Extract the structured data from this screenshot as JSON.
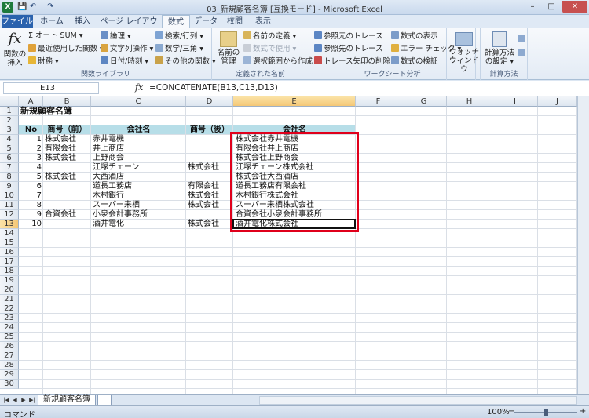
{
  "window": {
    "title": "03_新規顧客名簿  [互換モード] - Microsoft Excel",
    "app_icon": "X",
    "minimize": "–",
    "maximize": "□",
    "close": "✕"
  },
  "quick_access": [
    "💾",
    "↶",
    "↷"
  ],
  "ribbon_tabs": {
    "file": "ファイル",
    "home": "ホーム",
    "insert": "挿入",
    "page_layout": "ページ レイアウト",
    "formulas": "数式",
    "data": "データ",
    "review": "校閲",
    "view": "表示"
  },
  "ribbon": {
    "function_library": {
      "label": "関数ライブラリ",
      "insert_function": "関数の\n挿入",
      "autosum": "Σ オート SUM ▾",
      "recent": "最近使用した関数 ▾",
      "financial": "財務 ▾",
      "logical": "論理 ▾",
      "text": "文字列操作 ▾",
      "datetime": "日付/時刻 ▾",
      "lookup": "検索/行列 ▾",
      "math": "数学/三角 ▾",
      "more": "その他の関数 ▾"
    },
    "defined_names": {
      "label": "定義された名前",
      "name_manager": "名前の\n管理",
      "define_name": "名前の定義 ▾",
      "use_in_formula": "数式で使用 ▾",
      "create_from_selection": "選択範囲から作成"
    },
    "formula_auditing": {
      "label": "ワークシート分析",
      "trace_precedents": "参照元のトレース",
      "trace_dependents": "参照先のトレース",
      "remove_arrows": "トレース矢印の削除 ▾",
      "show_formulas": "数式の表示",
      "error_check": "エラー チェック ▾",
      "evaluate": "数式の検証",
      "watch": "ウォッチ\nウィンドウ"
    },
    "calculation": {
      "label": "計算方法",
      "options": "計算方法\nの設定 ▾"
    }
  },
  "formula_bar": {
    "name_box": "E13",
    "fx": "fx",
    "formula": "=CONCATENATE(B13,C13,D13)"
  },
  "columns": [
    "A",
    "B",
    "C",
    "D",
    "E",
    "F",
    "G",
    "H",
    "I",
    "J"
  ],
  "selected_column": "E",
  "selected_row": "13",
  "sheet_title": "新規顧客名簿",
  "table_headers": [
    "No",
    "商号（前）",
    "会社名",
    "商号（後）",
    "会社名"
  ],
  "rows": [
    {
      "no": "1",
      "pre": "株式会社",
      "name": "赤井電機",
      "post": "",
      "full": "株式会社赤井電機"
    },
    {
      "no": "2",
      "pre": "有限会社",
      "name": "井上商店",
      "post": "",
      "full": "有限会社井上商店"
    },
    {
      "no": "3",
      "pre": "株式会社",
      "name": "上野商会",
      "post": "",
      "full": "株式会社上野商会"
    },
    {
      "no": "4",
      "pre": "",
      "name": "江塚チェーン",
      "post": "株式会社",
      "full": "江塚チェーン株式会社"
    },
    {
      "no": "5",
      "pre": "株式会社",
      "name": "大西酒店",
      "post": "",
      "full": "株式会社大西酒店"
    },
    {
      "no": "6",
      "pre": "",
      "name": "道長工務店",
      "post": "有限会社",
      "full": "道長工務店有限会社"
    },
    {
      "no": "7",
      "pre": "",
      "name": "木村銀行",
      "post": "株式会社",
      "full": "木村銀行株式会社"
    },
    {
      "no": "8",
      "pre": "",
      "name": "スーパー来栖",
      "post": "株式会社",
      "full": "スーパー来栖株式会社"
    },
    {
      "no": "9",
      "pre": "合資会社",
      "name": "小泉会計事務所",
      "post": "",
      "full": "合資会社小泉会計事務所"
    },
    {
      "no": "10",
      "pre": "",
      "name": "酒井電化",
      "post": "株式会社",
      "full": "酒井電化株式会社"
    }
  ],
  "row_numbers": [
    "1",
    "2",
    "3",
    "4",
    "5",
    "6",
    "7",
    "8",
    "9",
    "10",
    "11",
    "12",
    "13",
    "14",
    "15",
    "16",
    "17",
    "18",
    "19",
    "20",
    "21",
    "22",
    "23",
    "24",
    "25",
    "26",
    "27",
    "28",
    "29",
    "30"
  ],
  "sheet_tabs": {
    "active": "新規顧客名簿",
    "nav": [
      "|◀",
      "◀",
      "▶",
      "▶|"
    ]
  },
  "status_bar": {
    "mode": "コマンド",
    "zoom": "100%",
    "zoom_minus": "−",
    "zoom_plus": "+"
  },
  "colors": {
    "header_fill": "#b7dee8",
    "highlight_box": "#e0001b",
    "file_tab": "#2a62ad"
  }
}
